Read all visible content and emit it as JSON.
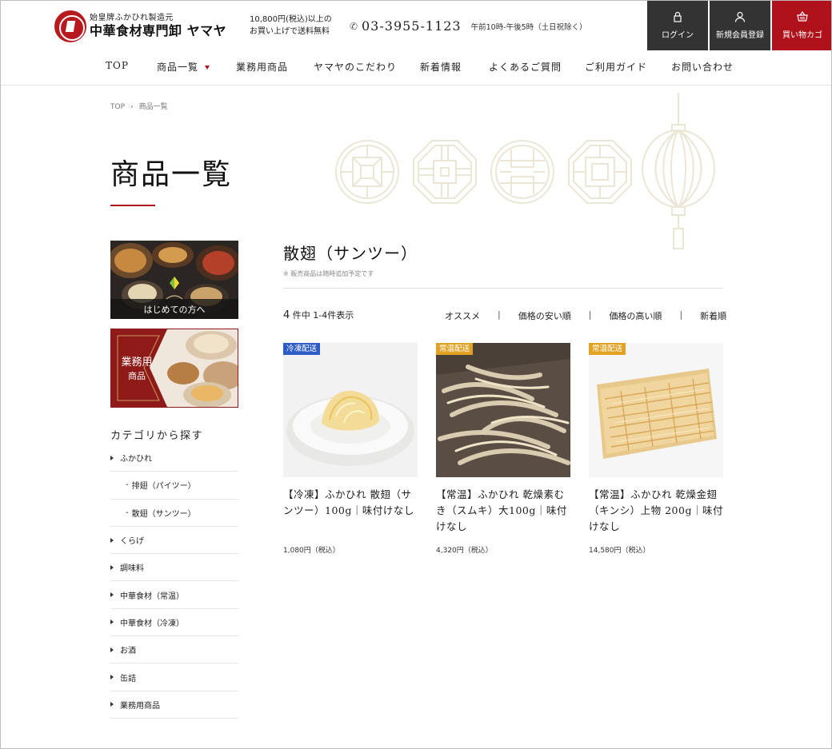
{
  "header": {
    "logo_sub": "始皇牌ふかひれ製造元",
    "logo_main": "中華食材専門卸 ヤマヤ",
    "ship_note_1": "10,800円(税込)以上の",
    "ship_note_2": "お買い上げで送料無料",
    "phone": "03-3955-1123",
    "hours": "午前10時-午後5時（土日祝除く）",
    "login_label": "ログイン",
    "register_label": "新規会員登録",
    "cart_label": "買い物カゴ"
  },
  "nav": {
    "items": [
      {
        "label": "TOP"
      },
      {
        "label": "商品一覧"
      },
      {
        "label": "業務用商品"
      },
      {
        "label": "ヤマヤのこだわり"
      },
      {
        "label": "新着情報"
      },
      {
        "label": "よくあるご質問"
      },
      {
        "label": "ご利用ガイド"
      },
      {
        "label": "お問い合わせ"
      }
    ]
  },
  "breadcrumb": {
    "home": "TOP",
    "sep": "›",
    "current": "商品一覧"
  },
  "page_title": "商品一覧",
  "sidebar": {
    "banner1_label": "はじめての方へ",
    "banner2_line1": "業務用",
    "banner2_line2": "商品",
    "category_title": "カテゴリから探す",
    "categories": [
      {
        "label": "ふかひれ"
      },
      {
        "label": "排翅（パイツー）"
      },
      {
        "label": "散翅（サンツー）"
      },
      {
        "label": "くらげ"
      },
      {
        "label": "調味料"
      },
      {
        "label": "中華食材（常温）"
      },
      {
        "label": "中華食材（冷凍）"
      },
      {
        "label": "お酒"
      },
      {
        "label": "缶詰"
      },
      {
        "label": "業務用商品"
      }
    ]
  },
  "main": {
    "section_title": "散翅（サンツー）",
    "section_note": "※ 販売商品は随時追加予定です",
    "count_num": "4",
    "count_text": " 件中 1-4件表示",
    "sorts": [
      "オススメ",
      "価格の安い順",
      "価格の高い順",
      "新着順"
    ],
    "sort_sep": "|",
    "products": [
      {
        "tag": "冷凍配送",
        "name": "【冷凍】ふかひれ 散翅（サンツー）100g｜味付けなし",
        "price": "1,080円（税込）"
      },
      {
        "tag": "常温配送",
        "name": "【常温】ふかひれ 乾燥素むき（スムキ）大100g｜味付けなし",
        "price": "4,320円（税込）"
      },
      {
        "tag": "常温配送",
        "name": "【常温】ふかひれ 乾燥金翅（キンシ）上物 200g｜味付けなし",
        "price": "14,580円（税込）"
      }
    ]
  },
  "colors": {
    "accent": "#b0121b",
    "dark_button": "#333333",
    "frozen_tag": "#2d5cc7",
    "normal_tag": "#e2a224"
  }
}
